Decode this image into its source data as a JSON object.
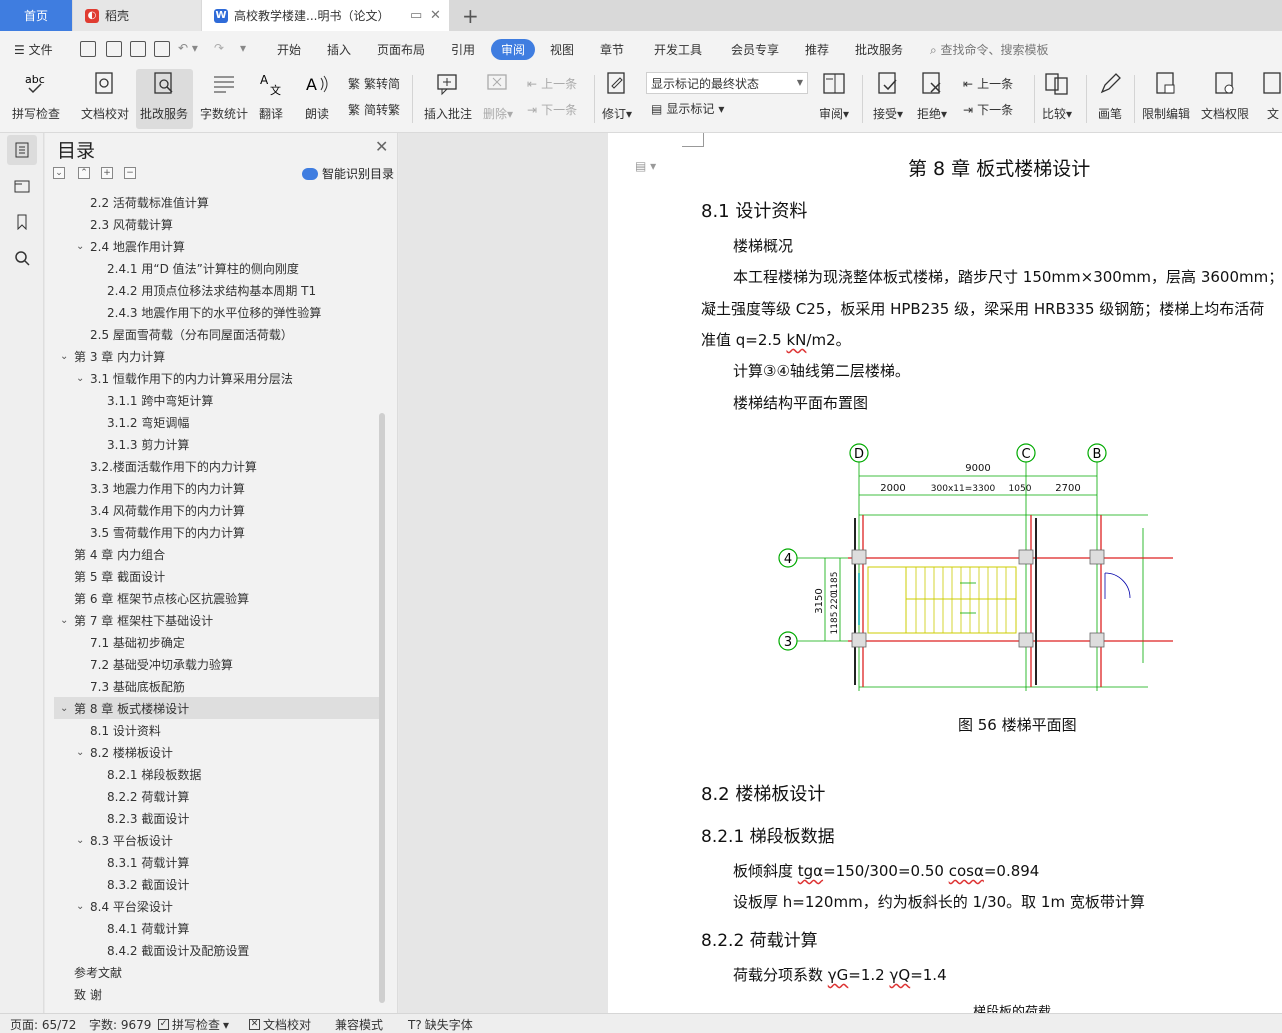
{
  "tabs": {
    "home": "首页",
    "daoke": "稻壳",
    "document": "高校教学楼建...明书（论文）"
  },
  "menu": {
    "file": "文件",
    "items": [
      "开始",
      "插入",
      "页面布局",
      "引用",
      "审阅",
      "视图",
      "章节",
      "开发工具",
      "会员专享",
      "推荐",
      "批改服务"
    ],
    "active": "审阅",
    "search": "查找命令、搜索模板"
  },
  "ribbon": {
    "spell_check": "拼写检查",
    "doc_proof": "文档校对",
    "correct_service": "批改服务",
    "word_count": "字数统计",
    "translate": "翻译",
    "read_aloud": "朗读",
    "trad_to_simp": "繁转简",
    "simp_to_trad": "简转繁",
    "insert_comment": "插入批注",
    "delete": "删除",
    "prev": "上一条",
    "next": "下一条",
    "revise": "修订",
    "markup_select": "显示标记的最终状态",
    "show_markup": "显示标记",
    "review": "审阅",
    "accept": "接受",
    "reject": "拒绝",
    "prev2": "上一条",
    "next2": "下一条",
    "compare": "比较",
    "pen": "画笔",
    "restrict_edit": "限制编辑",
    "doc_permission": "文档权限",
    "doc_cut": "文"
  },
  "toc": {
    "title": "目录",
    "smart": "智能识别目录",
    "items": [
      {
        "text": "2.2  活荷载标准值计算",
        "level": 2,
        "chev": ""
      },
      {
        "text": "2.3  风荷载计算",
        "level": 2,
        "chev": ""
      },
      {
        "text": "2.4 地震作用计算",
        "level": 2,
        "chev": "v"
      },
      {
        "text": "2.4.1  用“D 值法”计算柱的侧向刚度",
        "level": 3,
        "chev": ""
      },
      {
        "text": "2.4.2 用顶点位移法求结构基本周期 T1",
        "level": 3,
        "chev": ""
      },
      {
        "text": "2.4.3  地震作用下的水平位移的弹性验算",
        "level": 3,
        "chev": ""
      },
      {
        "text": "2.5  屋面雪荷载（分布同屋面活荷载）",
        "level": 2,
        "chev": ""
      },
      {
        "text": "第 3 章  内力计算",
        "level": 1,
        "chev": "v"
      },
      {
        "text": "3.1  恒载作用下的内力计算采用分层法",
        "level": 2,
        "chev": "v"
      },
      {
        "text": "3.1.1 跨中弯矩计算",
        "level": 3,
        "chev": ""
      },
      {
        "text": "3.1.2 弯矩调幅",
        "level": 3,
        "chev": ""
      },
      {
        "text": "3.1.3 剪力计算",
        "level": 3,
        "chev": ""
      },
      {
        "text": "3.2.楼面活载作用下的内力计算",
        "level": 2,
        "chev": ""
      },
      {
        "text": "3.3  地震力作用下的内力计算",
        "level": 2,
        "chev": ""
      },
      {
        "text": "3.4  风荷载作用下的内力计算",
        "level": 2,
        "chev": ""
      },
      {
        "text": "3.5 雪荷载作用下的内力计算",
        "level": 2,
        "chev": ""
      },
      {
        "text": "第 4 章  内力组合",
        "level": 1,
        "chev": ""
      },
      {
        "text": "第 5 章    截面设计",
        "level": 1,
        "chev": ""
      },
      {
        "text": "第 6 章  框架节点核心区抗震验算",
        "level": 1,
        "chev": ""
      },
      {
        "text": "第 7 章  框架柱下基础设计",
        "level": 1,
        "chev": "v"
      },
      {
        "text": "7.1  基础初步确定",
        "level": 2,
        "chev": ""
      },
      {
        "text": "7.2 基础受冲切承载力验算",
        "level": 2,
        "chev": ""
      },
      {
        "text": "7.3  基础底板配筋",
        "level": 2,
        "chev": ""
      },
      {
        "text": "第 8 章  板式楼梯设计",
        "level": 1,
        "chev": "v",
        "selected": true
      },
      {
        "text": "8.1  设计资料",
        "level": 2,
        "chev": ""
      },
      {
        "text": "8.2 楼梯板设计",
        "level": 2,
        "chev": "v"
      },
      {
        "text": "8.2.1 梯段板数据",
        "level": 3,
        "chev": ""
      },
      {
        "text": "8.2.2 荷载计算",
        "level": 3,
        "chev": ""
      },
      {
        "text": "8.2.3 截面设计",
        "level": 3,
        "chev": ""
      },
      {
        "text": "8.3 平台板设计",
        "level": 2,
        "chev": "v"
      },
      {
        "text": "8.3.1 荷载计算",
        "level": 3,
        "chev": ""
      },
      {
        "text": "8.3.2 截面设计",
        "level": 3,
        "chev": ""
      },
      {
        "text": "8.4 平台梁设计",
        "level": 2,
        "chev": "v"
      },
      {
        "text": "8.4.1 荷载计算",
        "level": 3,
        "chev": ""
      },
      {
        "text": "8.4.2 截面设计及配筋设置",
        "level": 3,
        "chev": ""
      },
      {
        "text": "参考文献",
        "level": 1,
        "chev": ""
      },
      {
        "text": "致    谢",
        "level": 1,
        "chev": ""
      }
    ]
  },
  "doc": {
    "chapter_title": "第 8 章  板式楼梯设计",
    "s81": "8.1 设计资料",
    "p1": "楼梯概况",
    "p2": "本工程楼梯为现浇整体板式楼梯，踏步尺寸 150mm×300mm，层高 3600mm；采",
    "p3": "凝土强度等级 C25，板采用 HPB235 级，梁采用 HRB335 级钢筋；楼梯上均布活荷",
    "p4a": "准值 q=2.5 ",
    "p4b": "kN",
    "p4c": "/m2。",
    "p5": "计算③④轴线第二层楼梯。",
    "p6": "楼梯结构平面布置图",
    "caption": "图 56    楼梯平面图",
    "s82": "8.2 楼梯板设计",
    "s821": "8.2.1 梯段板数据",
    "p7a": "板倾斜度 ",
    "p7b": "tgα",
    "p7c": "=150/300=0.50        ",
    "p7d": "cosα",
    "p7e": "=0.894",
    "p8": "设板厚 h=120mm，约为板斜长的 1/30。取 1m 宽板带计算",
    "s822": "8.2.2 荷载计算",
    "p9a": "荷载分项系数       ",
    "p9b": "γG",
    "p9c": "=1.2      ",
    "p9d": "γQ",
    "p9e": "=1.4",
    "p10": "梯段板的荷载",
    "drawing": {
      "axis_d": "D",
      "axis_c": "C",
      "axis_b": "B",
      "axis_4": "4",
      "axis_3": "3",
      "dim_total": "9000",
      "dim1": "2000",
      "dim2": "300x11=3300",
      "dim3": "1050",
      "dim4": "2700",
      "dim_v_total": "3150",
      "dim_v1": "1185",
      "dim_v2": "220",
      "dim_v3": "1185"
    }
  },
  "status": {
    "page": "页面: 65/72",
    "words": "字数: 9679",
    "spell": "拼写检查",
    "proof": "文档校对",
    "compat": "兼容模式",
    "missing_font": "缺失字体"
  },
  "colors": {
    "accent": "#3f7de0",
    "selected_row": "#dedede"
  }
}
